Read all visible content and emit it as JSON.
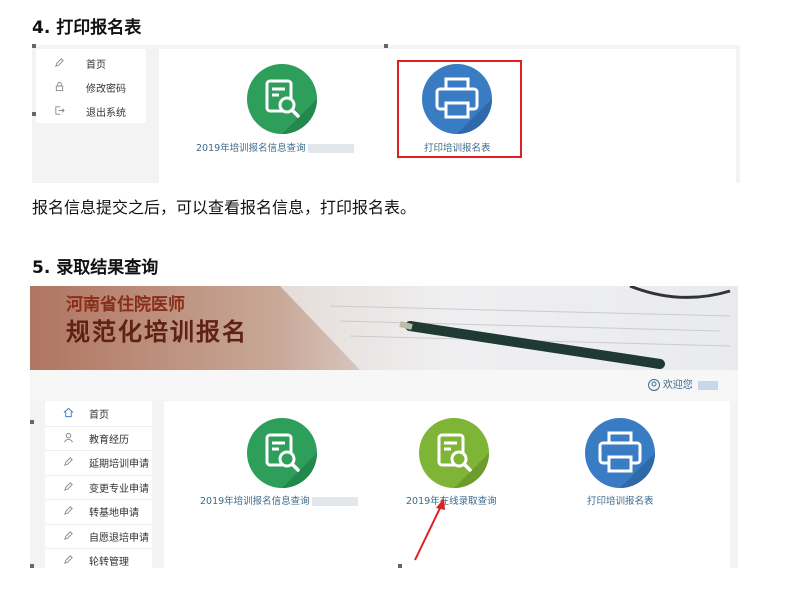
{
  "section4": {
    "heading": "4.  打印报名表",
    "sidebar": [
      "首页",
      "修改密码",
      "退出系统"
    ],
    "tiles": [
      {
        "label": "2019年培训报名信息查询",
        "icon": "search-document-icon",
        "color": "#2e9e5b"
      },
      {
        "label": "打印培训报名表",
        "icon": "printer-icon",
        "color": "#3a7cc4"
      }
    ],
    "highlight_color": "#e02020",
    "paragraph": "报名信息提交之后，可以查看报名信息，打印报名表。"
  },
  "section5": {
    "heading": "5.  录取结果查询",
    "banner": {
      "line1": "河南省住院医师",
      "line2": "规范化培训报名"
    },
    "welcome": "欢迎您",
    "sidebar": [
      "首页",
      "教育经历",
      "延期培训申请",
      "变更专业申请",
      "转基地申请",
      "自愿退培申请",
      "轮转管理"
    ],
    "tiles": [
      {
        "label": "2019年培训报名信息查询",
        "icon": "search-document-icon",
        "color": "#2e9e5b"
      },
      {
        "label": "2019年在线录取查询",
        "icon": "search-document-icon",
        "color": "#7fb536"
      },
      {
        "label": "打印培训报名表",
        "icon": "printer-icon",
        "color": "#3a7cc4"
      }
    ],
    "arrow_color": "#e02020"
  }
}
